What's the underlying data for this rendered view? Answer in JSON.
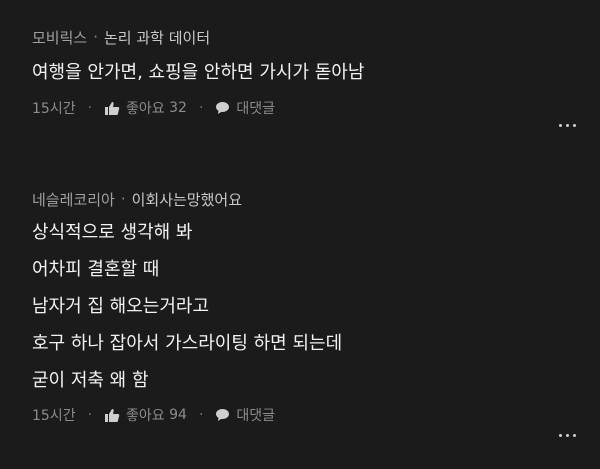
{
  "comments": [
    {
      "author": "모비릭스",
      "separator": "·",
      "tag": "논리 과학 데이터",
      "lines": [
        "여행을 안가면, 쇼핑을 안하면 가시가 돋아남"
      ],
      "time": "15시간",
      "like_label": "좋아요",
      "like_count": "32",
      "reply_label": "대댓글",
      "icons": {
        "like": "thumbs-up-icon",
        "reply": "speech-bubble-icon",
        "more": "more-dots-icon"
      }
    },
    {
      "author": "네슬레코리아",
      "separator": "·",
      "tag": "이회사는망했어요",
      "lines": [
        "상식적으로 생각해 봐",
        "어차피 결혼할 때",
        "남자거 집 해오는거라고",
        "호구 하나 잡아서 가스라이팅 하면 되는데",
        "굳이 저축 왜 함"
      ],
      "time": "15시간",
      "like_label": "좋아요",
      "like_count": "94",
      "reply_label": "대댓글",
      "icons": {
        "like": "thumbs-up-icon",
        "reply": "speech-bubble-icon",
        "more": "more-dots-icon"
      }
    }
  ],
  "colors": {
    "background": "#1b1b1b",
    "text": "#f2f2f2",
    "meta": "#8c8c8c"
  }
}
